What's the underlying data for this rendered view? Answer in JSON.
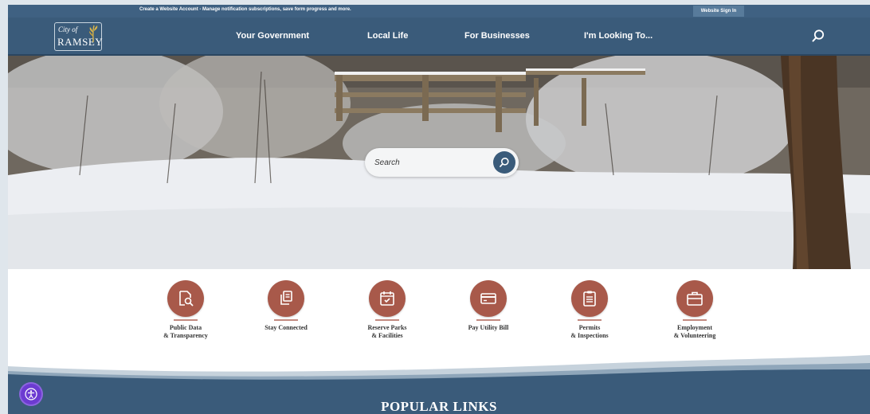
{
  "utility": {
    "message": "Create a Website Account - Manage notification subscriptions, save form progress and more.",
    "sign_in": "Website Sign In"
  },
  "logo": {
    "line1": "City of",
    "line2": "RAMSEY"
  },
  "nav": {
    "items": [
      {
        "label": "Your Government"
      },
      {
        "label": "Local Life"
      },
      {
        "label": "For Businesses"
      },
      {
        "label": "I'm Looking To..."
      }
    ],
    "search_icon": "search-icon"
  },
  "hero": {
    "search_placeholder": "Search",
    "search_icon": "search-icon"
  },
  "quick_links": [
    {
      "line1": "Public Data",
      "line2": "& Transparency",
      "icon": "document-search-icon"
    },
    {
      "line1": "Stay Connected",
      "line2": "",
      "icon": "newsletter-icon"
    },
    {
      "line1": "Reserve Parks",
      "line2": "& Facilities",
      "icon": "calendar-check-icon"
    },
    {
      "line1": "Pay Utility Bill",
      "line2": "",
      "icon": "credit-card-icon"
    },
    {
      "line1": "Permits",
      "line2": "& Inspections",
      "icon": "clipboard-icon"
    },
    {
      "line1": "Employment",
      "line2": "& Volunteering",
      "icon": "briefcase-icon"
    }
  ],
  "popular": {
    "title": "POPULAR LINKS"
  },
  "colors": {
    "nav": "#3a5b7a",
    "accent": "#a8594a",
    "accessibility": "#6c3bd1"
  }
}
